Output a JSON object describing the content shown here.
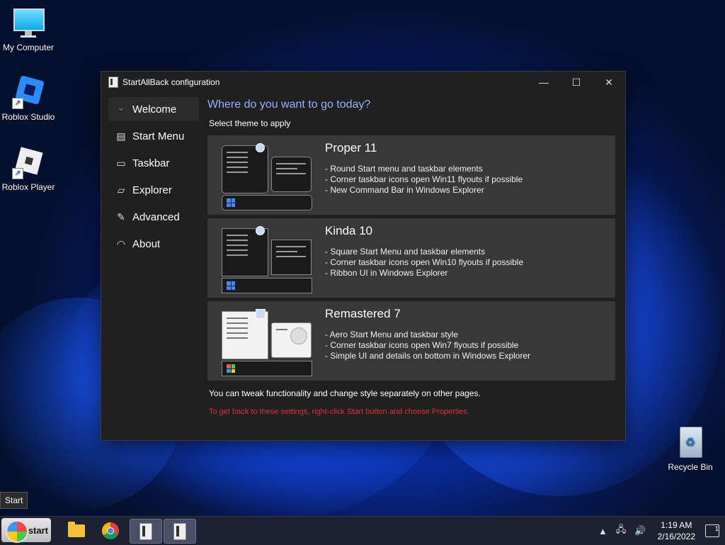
{
  "desktop": {
    "icons": [
      {
        "label": "My Computer"
      },
      {
        "label": "Roblox Studio"
      },
      {
        "label": "Roblox Player"
      },
      {
        "label": "Recycle Bin"
      }
    ]
  },
  "window": {
    "title": "StartAllBack configuration",
    "controls": {
      "minimize": "—",
      "maximize": "☐",
      "close": "✕"
    }
  },
  "sidebar": {
    "items": [
      {
        "label": "Welcome",
        "icon": "smile-icon",
        "glyph": "ᵕ"
      },
      {
        "label": "Start Menu",
        "icon": "start-menu-icon",
        "glyph": "▤"
      },
      {
        "label": "Taskbar",
        "icon": "taskbar-icon",
        "glyph": "▭"
      },
      {
        "label": "Explorer",
        "icon": "folder-icon",
        "glyph": "▱"
      },
      {
        "label": "Advanced",
        "icon": "wrench-icon",
        "glyph": "✎"
      },
      {
        "label": "About",
        "icon": "gauge-icon",
        "glyph": "◠"
      }
    ]
  },
  "main": {
    "heading": "Where do you want to go today?",
    "subheading": "Select theme to apply",
    "themes": [
      {
        "name": "Proper 11",
        "features": [
          "Round Start menu and taskbar elements",
          "Corner taskbar icons open Win11 flyouts if possible",
          "New Command Bar in Windows Explorer"
        ]
      },
      {
        "name": "Kinda 10",
        "features": [
          "Square Start Menu and taskbar elements",
          "Corner taskbar icons open Win10 flyouts if possible",
          "Ribbon UI in Windows Explorer"
        ]
      },
      {
        "name": "Remastered 7",
        "features": [
          "Aero Start Menu and taskbar style",
          "Corner taskbar icons open Win7 flyouts if possible",
          "Simple UI and details on bottom in Windows Explorer"
        ]
      }
    ],
    "note": "You can tweak functionality and change style separately on other pages.",
    "hint": "To get back to these settings, right-click Start button and choose Properties."
  },
  "taskbar": {
    "tooltip": "Start",
    "start_label": "start",
    "time": "1:19 AM",
    "date": "2/16/2022",
    "notifications": "1",
    "tray_glyphs": {
      "chevron": "▲",
      "network": "🖧",
      "volume": "🔊"
    }
  },
  "colors": {
    "accent": "#8fb4ff",
    "hint": "#e03030",
    "card_bg": "#383838",
    "window_bg": "#202020"
  }
}
